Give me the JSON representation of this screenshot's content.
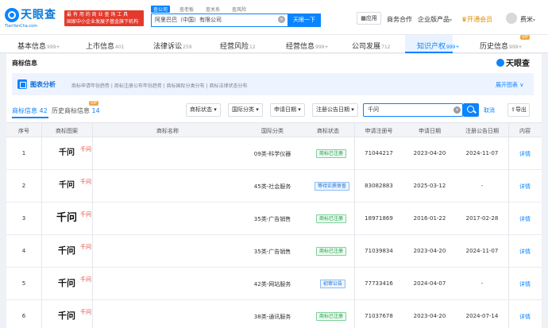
{
  "header": {
    "logo_text": "天眼查",
    "logo_domain": "TianYanCha.com",
    "slogan_line1": "最 有 用 的 商 业 查 询 工 具",
    "slogan_line2": "国家中小企业发展子基金旗下机构",
    "search_tabs": [
      "查公司",
      "查老板",
      "查关系",
      "查风险"
    ],
    "search_value": "阿里巴巴（中国）有限公司",
    "search_button": "天眼一下",
    "app_label": "应用",
    "menu": [
      "商务合作",
      "企业版产品",
      "开通会员"
    ],
    "user_name": "费米"
  },
  "tabs": [
    {
      "label": "基本信息",
      "count": "999+"
    },
    {
      "label": "上市信息",
      "count": "401"
    },
    {
      "label": "法律诉讼",
      "count": "259"
    },
    {
      "label": "经营风险",
      "count": "12"
    },
    {
      "label": "经营信息",
      "count": "999+"
    },
    {
      "label": "公司发展",
      "count": "712"
    },
    {
      "label": "知识产权",
      "count": "999+"
    },
    {
      "label": "历史信息",
      "count": "999+"
    }
  ],
  "vip_tag": "VIP",
  "panel": {
    "title": "商标信息",
    "watermark": "天眼查",
    "analysis_title": "图表分析",
    "analysis_links": "商标申请年份趋势 | 商标注册公布年份趋势 | 商标国际分类分布 | 商标法律状态分布",
    "analysis_expand": "展开图表 ∨",
    "filter_tab_active": "商标信息",
    "filter_tab_active_count": "42",
    "filter_tab_other": "历史商标信息",
    "filter_tab_other_count": "14",
    "dropdowns": [
      "商标状态",
      "国际分类",
      "申请日期",
      "注册公告日期"
    ],
    "filter_value": "千问",
    "cancel": "取消",
    "export": "导出"
  },
  "table": {
    "headers": [
      "序号",
      "商标图案",
      "商标名称",
      "国际分类",
      "商标状态",
      "申请注册号",
      "申请日期",
      "注册公告日期",
      "内容"
    ],
    "rows": [
      {
        "no": "1",
        "image_text": "千问",
        "name": "千问",
        "class": "09类-科学仪器",
        "status": "商标已注册",
        "status_color": "green",
        "reg_no": "71044217",
        "apply_date": "2023-04-20",
        "pub_date": "2024-11-07",
        "detail": "详情"
      },
      {
        "no": "2",
        "image_text": "千问",
        "name": "千问",
        "class": "45类-社会服务",
        "status": "等待实质审查",
        "status_color": "blue",
        "reg_no": "83082883",
        "apply_date": "2025-03-12",
        "pub_date": "-",
        "detail": "详情"
      },
      {
        "no": "3",
        "image_text": "千问",
        "name": "千问",
        "class": "35类-广告销售",
        "status": "商标已注册",
        "status_color": "green",
        "reg_no": "18971869",
        "apply_date": "2016-01-22",
        "pub_date": "2017-02-28",
        "detail": "详情"
      },
      {
        "no": "4",
        "image_text": "千问",
        "name": "千问",
        "class": "35类-广告销售",
        "status": "商标已注册",
        "status_color": "green",
        "reg_no": "71039834",
        "apply_date": "2023-04-20",
        "pub_date": "2024-11-07",
        "detail": "详情"
      },
      {
        "no": "5",
        "image_text": "千问",
        "name": "千问",
        "class": "42类-网站服务",
        "status": "初审公告",
        "status_color": "blue",
        "reg_no": "77733416",
        "apply_date": "2024-04-07",
        "pub_date": "-",
        "detail": "详情"
      },
      {
        "no": "6",
        "image_text": "千问",
        "name": "千问",
        "class": "38类-通讯服务",
        "status": "商标已注册",
        "status_color": "green",
        "reg_no": "71037678",
        "apply_date": "2023-04-20",
        "pub_date": "2024-07-14",
        "detail": "详情"
      }
    ]
  }
}
